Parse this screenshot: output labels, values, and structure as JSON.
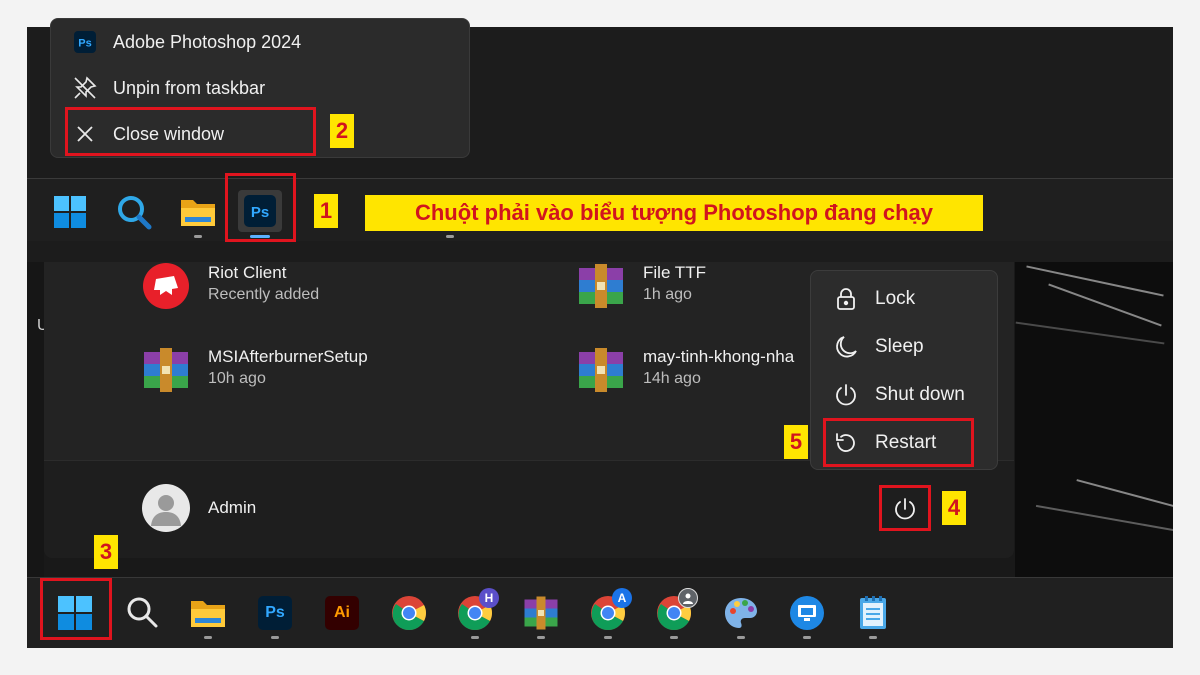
{
  "jumplist": {
    "items": [
      {
        "label": "Adobe Photoshop 2024",
        "icon": "photoshop-icon"
      },
      {
        "label": "Unpin from taskbar",
        "icon": "unpin-icon"
      },
      {
        "label": "Close window",
        "icon": "close-icon"
      }
    ]
  },
  "instruction_banner": "Chuột phải vào biểu tượng Photoshop đang chạy",
  "steps": [
    "1",
    "2",
    "3",
    "4",
    "5"
  ],
  "top_taskbar": {
    "icons": [
      "windows-start-icon",
      "search-icon",
      "file-explorer-icon",
      "photoshop-icon"
    ]
  },
  "start_menu": {
    "recommended": [
      {
        "name": "Riot Client",
        "time": "Recently added",
        "icon": "riot-client-icon"
      },
      {
        "name": "File TTF",
        "time": "1h ago",
        "icon": "winrar-icon"
      },
      {
        "name": "MSIAfterburnerSetup",
        "time": "10h ago",
        "icon": "winrar-icon"
      },
      {
        "name": "may-tinh-khong-nha",
        "time": "14h ago",
        "icon": "winrar-icon"
      }
    ],
    "user": {
      "name": "Admin"
    },
    "power_menu": [
      {
        "label": "Lock",
        "icon": "lock-icon"
      },
      {
        "label": "Sleep",
        "icon": "moon-icon"
      },
      {
        "label": "Shut down",
        "icon": "power-icon"
      },
      {
        "label": "Restart",
        "icon": "restart-icon"
      }
    ],
    "partial_left_letter": "U"
  },
  "bottom_taskbar": {
    "app_labels": {
      "ps": "Ps",
      "ai": "Ai"
    },
    "profile_badges": {
      "chrome_h": "H",
      "chrome_a": "A"
    }
  },
  "colors": {
    "annotation_red": "#e0141e",
    "annotation_yellow": "#ffe500",
    "ps_blue": "#31a8ff",
    "ai_orange": "#ff9a00"
  }
}
